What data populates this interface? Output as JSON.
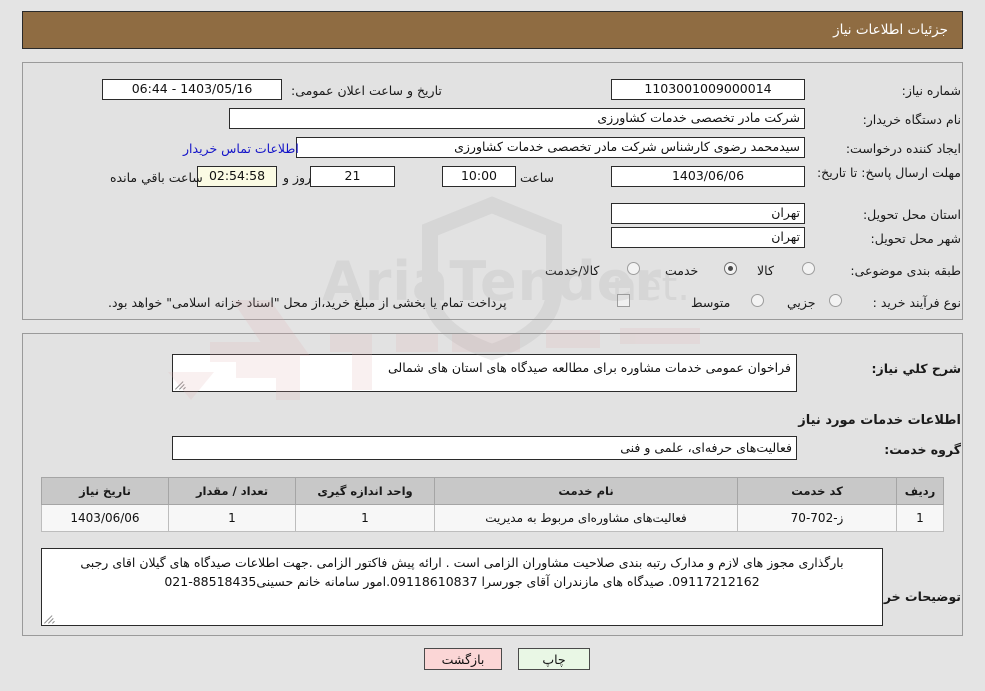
{
  "header": {
    "title": "جزئیات اطلاعات نیاز"
  },
  "form": {
    "need_number_label": "شماره نیاز:",
    "need_number_value": "1103001009000014",
    "announce_datetime_label": "تاریخ و ساعت اعلان عمومی:",
    "announce_datetime_value": "1403/05/16 - 06:44",
    "buyer_org_label": "نام دستگاه خریدار:",
    "buyer_org_value": "شرکت مادر تخصصی خدمات کشاورزی",
    "requester_label": "ایجاد کننده درخواست:",
    "requester_value": "سیدمحمد رضوی کارشناس شرکت مادر تخصصی خدمات کشاورزی",
    "buyer_contact_link": "اطلاعات تماس خریدار",
    "deadline_label": "مهلت ارسال پاسخ: تا تاریخ:",
    "deadline_date": "1403/06/06",
    "deadline_hour_label": "ساعت",
    "deadline_hour": "10:00",
    "remaining_days": "21",
    "remaining_days_label": "روز و",
    "remaining_time": "02:54:58",
    "remaining_time_label": "ساعت باقي مانده",
    "province_label": "استان محل تحویل:",
    "province_value": "تهران",
    "city_label": "شهر محل تحویل:",
    "city_value": "تهران",
    "category_label": "طبقه بندی موضوعی:",
    "category_options": [
      "کالا",
      "خدمت",
      "کالا/خدمت"
    ],
    "category_selected": "خدمت",
    "process_label": "نوع فرآیند خرید :",
    "process_options": [
      "جزیي",
      "متوسط"
    ],
    "process_selected": "",
    "payment_note": "پرداخت تمام یا بخشی از مبلغ خرید،از محل \"اسناد خزانه اسلامی\" خواهد بود."
  },
  "details": {
    "summary_label": "شرح کلي نیاز:",
    "summary_value": "فراخوان عمومی خدمات مشاوره برای مطالعه صیدگاه های استان های شمالی",
    "section_title": "اطلاعات خدمات مورد نیاز",
    "service_group_label": "گروه خدمت:",
    "service_group_value": "فعالیت‌های حرفه‌ای، علمی و فنی",
    "notes_label": "توضیحات خریدار:",
    "notes_value": "بارگذاری مجوز های لازم و مدارک رتبه بندی صلاحیت مشاوران الزامی است .  ارائه پیش فاکتور الزامی .جهت اطلاعات صیدگاه های گیلان اقای رجبی 09117212162. صیدگاه های مازندران آقای جورسرا 09118610837.امور سامانه خانم حسینی88518435-021"
  },
  "table": {
    "columns": [
      "ردیف",
      "کد خدمت",
      "نام خدمت",
      "واحد اندازه گیری",
      "تعداد / مقدار",
      "تاریخ نیاز"
    ],
    "rows": [
      {
        "row": "1",
        "code": "ز-702-70",
        "name": "فعالیت‌های مشاوره‌ای مربوط به مدیریت",
        "unit": "1",
        "qty": "1",
        "date": "1403/06/06"
      }
    ]
  },
  "footer": {
    "print_label": "چاپ",
    "back_label": "بازگشت"
  },
  "colors": {
    "header_bg": "#8f6c42",
    "page_bg": "#e4e4e4",
    "panel_bg": "#e2e2e2",
    "link": "#1414c8",
    "print_btn_bg": "#e9f7e5",
    "back_btn_bg": "#fbd6d6",
    "countdown_bg": "#fbfbe4",
    "table_header_bg": "#c8c8c8"
  }
}
